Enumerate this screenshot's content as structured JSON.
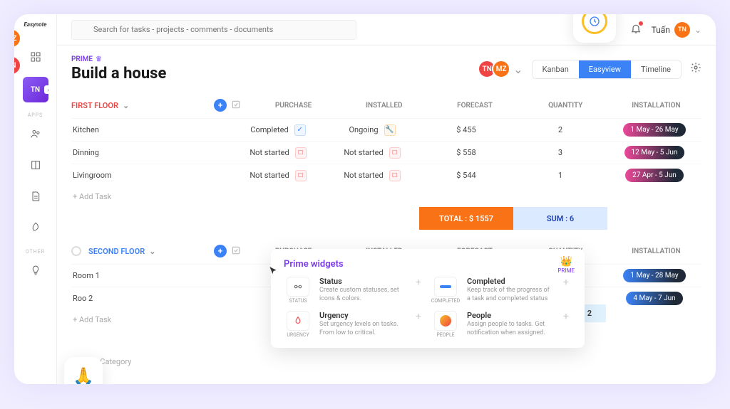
{
  "app_name": "Easynote",
  "search": {
    "placeholder": "Search for tasks - projects - comments - documents"
  },
  "user": {
    "name": "Tuấn",
    "initials": "TN"
  },
  "header": {
    "prime_label": "PRIME",
    "title": "Build a house",
    "members": [
      {
        "initials": "TN",
        "color": "#ef4444"
      },
      {
        "initials": "MZ",
        "color": "#f97316"
      }
    ],
    "views": {
      "kanban": "Kanban",
      "easyview": "Easyview",
      "timeline": "Timeline"
    }
  },
  "left_avatars": [
    {
      "initials": "MZ",
      "color": "#f97316"
    },
    {
      "initials": "TN",
      "color": "#ef4444"
    }
  ],
  "sidebar": {
    "apps_label": "APPS",
    "other_label": "OTHER",
    "active_initials": "TN"
  },
  "columns": {
    "purchase": "PURCHASE",
    "installed": "INSTALLED",
    "forecast": "FORECAST",
    "quantity": "QUANTITY",
    "installation": "INSTALLATION"
  },
  "sections": [
    {
      "name": "FIRST FLOOR",
      "color_class": "first",
      "rows": [
        {
          "name": "Kitchen",
          "purchase": "Completed",
          "purchase_state": "done",
          "installed": "Ongoing",
          "installed_state": "ongoing",
          "forecast": "$ 455",
          "quantity": "2",
          "installation": "1 May - 26 May",
          "pill": "pink"
        },
        {
          "name": "Dinning",
          "purchase": "Not started",
          "purchase_state": "none",
          "installed": "Not started",
          "installed_state": "none",
          "forecast": "$ 558",
          "quantity": "3",
          "installation": "12 May - 5 Jun",
          "pill": "pink"
        },
        {
          "name": "Livingroom",
          "purchase": "Not started",
          "purchase_state": "none",
          "installed": "Not started",
          "installed_state": "none",
          "forecast": "$ 544",
          "quantity": "1",
          "installation": "27 Apr - 5 Jun",
          "pill": "pink"
        }
      ],
      "totals": {
        "forecast": "TOTAL : $ 1557",
        "quantity": "SUM : 6"
      }
    },
    {
      "name": "SECOND FLOOR",
      "color_class": "second",
      "rows": [
        {
          "name": "Room 1",
          "installation": "1 May - 28 May",
          "pill": "blue"
        },
        {
          "name": "Roo 2",
          "installation": "4 May - 7 Jun",
          "pill": "blue"
        }
      ]
    }
  ],
  "actions": {
    "add_task": "+ Add Task",
    "add_category": "Add Category"
  },
  "sum_2": "2",
  "popover": {
    "title": "Prime widgets",
    "prime_label": "PRIME",
    "widgets": [
      {
        "icon_label": "STATUS",
        "title": "Status",
        "desc": "Create custom statuses, set icons & colors.",
        "icon": "status"
      },
      {
        "icon_label": "COMPLETED",
        "title": "Completed",
        "desc": "Keep track of the progress of a task and completed status",
        "icon": "completed"
      },
      {
        "icon_label": "URGENCY",
        "title": "Urgency",
        "desc": "Set urgency levels on tasks. From low to critical.",
        "icon": "urgency"
      },
      {
        "icon_label": "PEOPLE",
        "title": "People",
        "desc": "Assign people to tasks. Get notification when assigned.",
        "icon": "people"
      }
    ]
  }
}
